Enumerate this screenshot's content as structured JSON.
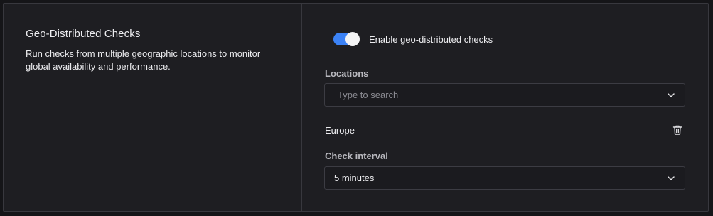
{
  "section": {
    "title": "Geo-Distributed Checks",
    "description": "Run checks from multiple geographic locations to monitor global availability and performance."
  },
  "toggle": {
    "label": "Enable geo-distributed checks",
    "enabled": true,
    "accent_color": "#3b82f6"
  },
  "locations": {
    "label": "Locations",
    "search_placeholder": "Type to search",
    "selected": [
      {
        "name": "Europe",
        "action_icon": "trash-icon"
      }
    ]
  },
  "check_interval": {
    "label": "Check interval",
    "value": "5 minutes"
  }
}
